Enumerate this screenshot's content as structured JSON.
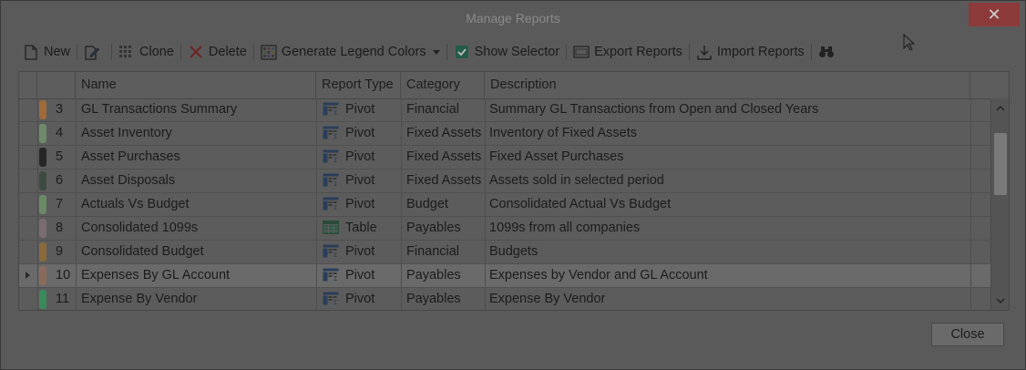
{
  "window": {
    "title": "Manage Reports",
    "close_glyph": "✕"
  },
  "toolbar": {
    "new": "New",
    "clone": "Clone",
    "delete": "Delete",
    "legend": "Generate Legend Colors",
    "show_selector": "Show Selector",
    "export": "Export Reports",
    "import": "Import Reports"
  },
  "grid": {
    "columns": {
      "name": "Name",
      "type": "Report Type",
      "category": "Category",
      "description": "Description"
    },
    "rows": [
      {
        "num": "3",
        "name": "GL Transactions Summary",
        "type": "Pivot",
        "category": "Financial",
        "description": "Summary GL Transactions from Open and Closed Years",
        "color": "#a06a3a"
      },
      {
        "num": "4",
        "name": "Asset Inventory",
        "type": "Pivot",
        "category": "Fixed Assets",
        "description": "Inventory of Fixed Assets",
        "color": "#6e8a6a"
      },
      {
        "num": "5",
        "name": "Asset Purchases",
        "type": "Pivot",
        "category": "Fixed Assets",
        "description": "Fixed Asset Purchases",
        "color": "#262626"
      },
      {
        "num": "6",
        "name": "Asset Disposals",
        "type": "Pivot",
        "category": "Fixed Assets",
        "description": "Assets sold in selected period",
        "color": "#3e4a40"
      },
      {
        "num": "7",
        "name": "Actuals Vs Budget",
        "type": "Pivot",
        "category": "Budget",
        "description": "Consolidated Actual Vs Budget",
        "color": "#6a8a66"
      },
      {
        "num": "8",
        "name": "Consolidated 1099s",
        "type": "Table",
        "category": "Payables",
        "description": "1099s from all companies",
        "color": "#7a6c72"
      },
      {
        "num": "9",
        "name": "Consolidated Budget",
        "type": "Pivot",
        "category": "Financial",
        "description": "Budgets",
        "color": "#8a6a3a"
      },
      {
        "num": "10",
        "name": "Expenses By GL Account",
        "type": "Pivot",
        "category": "Payables",
        "description": "Expenses by Vendor and GL Account",
        "color": "#8a6a5a",
        "selected": true
      },
      {
        "num": "11",
        "name": "Expense By Vendor",
        "type": "Pivot",
        "category": "Payables",
        "description": "Expense By Vendor",
        "color": "#3a8a5a"
      }
    ]
  },
  "footer": {
    "close": "Close"
  }
}
